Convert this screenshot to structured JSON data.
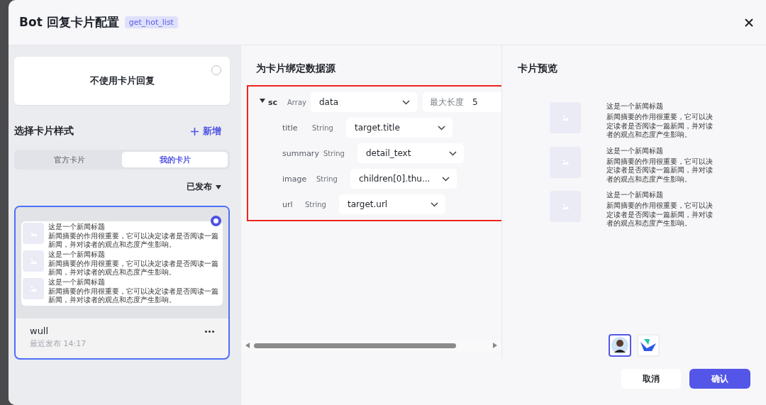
{
  "dialog": {
    "title": "Bot 回复卡片配置",
    "tag": "get_hot_list"
  },
  "left": {
    "no_card": {
      "label": "不使用卡片回复",
      "selected": false
    },
    "section_title": "选择卡片样式",
    "add_label": "新增",
    "tabs": [
      {
        "label": "官方卡片",
        "selected": false
      },
      {
        "label": "我的卡片",
        "selected": true
      }
    ],
    "filter": "已发布",
    "cards": [
      {
        "name": "wull",
        "meta": "最近发布 14:17",
        "selected": true,
        "items": [
          {
            "title": "这是一个新闻标题",
            "summary": "新闻摘要的作用很重要，它可以决定读者是否阅读一篇新闻，并对读者的观点和态度产生影响。"
          },
          {
            "title": "这是一个新闻标题",
            "summary": "新闻摘要的作用很重要，它可以决定读者是否阅读一篇新闻，并对读者的观点和态度产生影响。"
          },
          {
            "title": "这是一个新闻标题",
            "summary": "新闻摘要的作用很重要，它可以决定读者是否阅读一篇新闻，并对读者的观点和态度产生影响。"
          }
        ]
      }
    ]
  },
  "binding": {
    "title": "为卡片绑定数据源",
    "root": {
      "name": "sc",
      "type": "Array",
      "value": "data",
      "expanded": true,
      "max_label": "最大长度",
      "max_value": "5",
      "children": [
        {
          "name": "title",
          "type": "String",
          "value": "target.title"
        },
        {
          "name": "summary",
          "type": "String",
          "value": "detail_text"
        },
        {
          "name": "image",
          "type": "String",
          "value": "children[0].thu..."
        },
        {
          "name": "url",
          "type": "String",
          "value": "target.url"
        }
      ]
    }
  },
  "preview": {
    "title": "卡片预览",
    "items": [
      {
        "title": "这是一个新闻标题",
        "summary": "新闻摘要的作用很重要，它可以决定读者是否阅读一篇新闻，并对读者的观点和态度产生影响。"
      },
      {
        "title": "这是一个新闻标题",
        "summary": "新闻摘要的作用很重要，它可以决定读者是否阅读一篇新闻，并对读者的观点和态度产生影响。"
      },
      {
        "title": "这是一个新闻标题",
        "summary": "新闻摘要的作用很重要，它可以决定读者是否阅读一篇新闻，并对读者的观点和态度产生影响。"
      }
    ],
    "avatars": [
      {
        "kind": "person",
        "selected": true
      },
      {
        "kind": "logo",
        "selected": false
      }
    ]
  },
  "footer": {
    "buttons": [
      {
        "label": "取消",
        "kind": "secondary"
      },
      {
        "label": "确认",
        "kind": "primary"
      }
    ]
  }
}
